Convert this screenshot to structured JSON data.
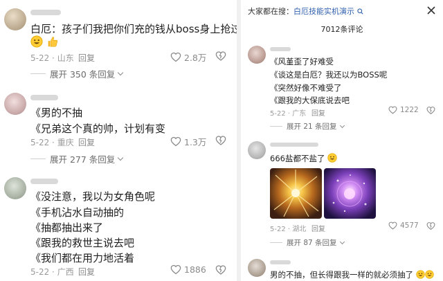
{
  "left": {
    "comments": [
      {
        "lines": [
          "白厄：孩子们我把你们充的钱从boss身上抢过来了"
        ],
        "emojis": [
          "grinning-face-emoji",
          "thumbs-up-emoji"
        ],
        "date": "5-22",
        "location": "山东",
        "reply": "回复",
        "likes": "2.8万",
        "expand": "展开 350 条回复"
      },
      {
        "lines": [
          "《男的不抽",
          "《兄弟这个真的帅，计划有变"
        ],
        "date": "5-22",
        "location": "重庆",
        "reply": "回复",
        "likes": "1.3万",
        "expand": "展开 277 条回复"
      },
      {
        "lines": [
          "《没注意，我以为女角色呢",
          "《手机沾水自动抽的",
          "《抽都抽出来了",
          "《跟我的救世主说去吧",
          "《我们都在用力地活着"
        ],
        "date": "5-22",
        "location": "广西",
        "reply": "回复",
        "likes": "1886"
      }
    ]
  },
  "right": {
    "search_prefix": "大家都在搜：",
    "search_term": "白厄技能实机演示",
    "comment_count": "7012条评论",
    "comments": [
      {
        "lines": [
          "《风堇歪了好难受",
          "《谈这是白厄？我还以为BOSS呢",
          "《突然好像不难受了",
          "《跟我的大保底说去吧"
        ],
        "date": "5-22",
        "location": "广东",
        "reply": "回复",
        "likes": "1222",
        "expand": "展开 21 条回复"
      },
      {
        "lines": [
          "666盐都不盐了"
        ],
        "emojis": [
          "grinning-face-emoji"
        ],
        "date": "5-22",
        "location": "湖北",
        "reply": "回复",
        "likes": "4577",
        "expand": "展开 87 条回复"
      },
      {
        "lines": [
          "男的不抽，但长得跟我一样的就必须抽了"
        ],
        "emojis": [
          "grinning-face-emoji",
          "grinning-face-emoji"
        ]
      }
    ]
  }
}
